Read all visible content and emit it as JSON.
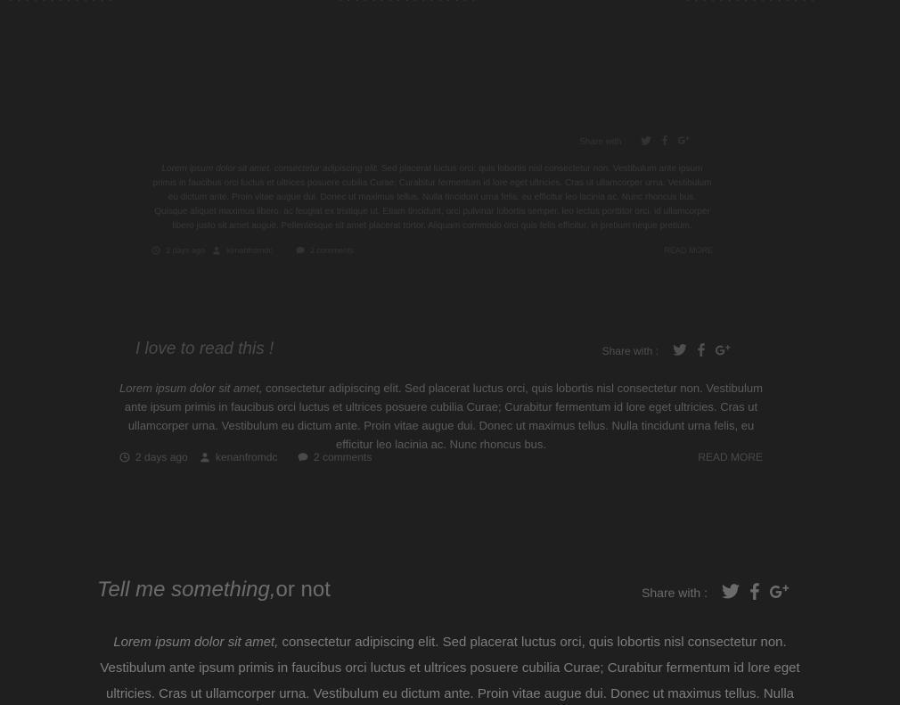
{
  "top_strip": {
    "fragments": [
      "· · · · · · · · · · · · ·",
      "· · · · · · · · · · · · · · · · ·",
      "· · · · · · · · · · · · · · · ·"
    ]
  },
  "posts": [
    {
      "title": "",
      "title_tail": "",
      "share_label": "Share with :",
      "excerpt_em": "Lorem ipsum dolor sit amet, consectetur adipiscing elit.",
      "excerpt": " Sed placerat luctus orci, quis lobortis nisl consectetur non. Vestibulum ante ipsum primis in faucibus orci luctus et ultrices posuere cubilia Curae; Curabitur fermentum id lore eget ultricies. Cras ut ullamcorper urna. Vestibulum eu dictum ante. Proin vitae augue dui. Donec ut maximus tellus. Nulla tincidunt urna felis, eu efficitur leo lacinia ac. Nunc rhoncus bus. Quisque aliquet maximus libero, ac feugiat ex tristique ut. Etiam tincidunt, orci pulvinar lobortis semper, leo lectus porttitor orci, id ullamcorper libero justo sit amet augue. Pellentesque sit amet placerat tortor. Aliquam commodo orci quis felis efficitur, in pretium neque pretium.",
      "date": "2 days ago",
      "author": "kenanfromdc",
      "comments": "2 comments",
      "read_more": "READ MORE"
    },
    {
      "title": "I love to read this !",
      "title_tail": "",
      "share_label": "Share with :",
      "excerpt_em": "Lorem ipsum dolor sit amet,",
      "excerpt": " consectetur adipiscing elit. Sed placerat luctus orci, quis lobortis nisl consectetur non. Vestibulum ante ipsum primis in faucibus orci luctus et ultrices posuere cubilia Curae; Curabitur fermentum id lore eget ultricies. Cras ut ullamcorper urna. Vestibulum eu dictum ante. Proin vitae augue dui. Donec ut maximus tellus. Nulla tincidunt urna felis, eu efficitur leo lacinia ac. Nunc rhoncus bus.",
      "date": "2 days ago",
      "author": "kenanfromdc",
      "comments": "2 comments",
      "read_more": "READ MORE"
    },
    {
      "title": "Tell me something,",
      "title_tail": "or not",
      "share_label": "Share with :",
      "excerpt_em": "Lorem ipsum dolor sit amet,",
      "excerpt": " consectetur adipiscing elit. Sed placerat luctus orci, quis lobortis nisl consectetur non. Vestibulum ante ipsum primis in faucibus orci luctus et ultrices posuere cubilia Curae; Curabitur fermentum id lore eget ultricies. Cras ut ullamcorper urna. Vestibulum eu dictum ante. Proin vitae augue dui. Donec ut maximus tellus. Nulla tincidunt urna felis, eu efficitur leo lacinia ac. Nunc rhoncus bus."
    }
  ],
  "icons": {
    "share": [
      "twitter-icon",
      "facebook-icon",
      "google-plus-icon"
    ],
    "meta": [
      "clock-icon",
      "user-icon",
      "comment-icon"
    ]
  },
  "colors": {
    "background": "#1f1f1f",
    "text": "#7d7d7d"
  }
}
